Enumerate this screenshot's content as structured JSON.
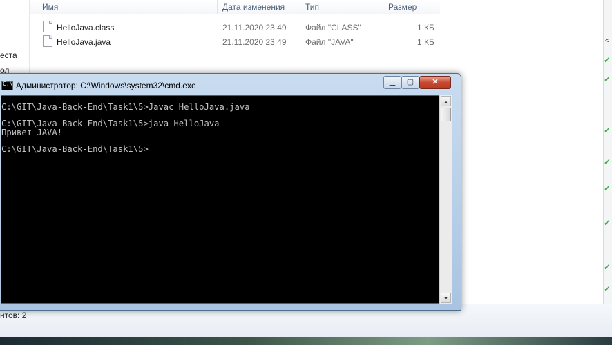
{
  "explorer": {
    "columns": {
      "name": "Имя",
      "date": "Дата изменения",
      "type": "Тип",
      "size": "Размер"
    },
    "files": [
      {
        "name": "HelloJava.class",
        "date": "21.11.2020 23:49",
        "type": "Файл \"CLASS\"",
        "size": "1 КБ"
      },
      {
        "name": "HelloJava.java",
        "date": "21.11.2020 23:49",
        "type": "Файл \"JAVA\"",
        "size": "1 КБ"
      }
    ],
    "nav_items": [
      "еста",
      "ол"
    ],
    "status": "нтов: 2"
  },
  "cmd": {
    "title": "Администратор: C:\\Windows\\system32\\cmd.exe",
    "icon_label": "C:\\",
    "console_text": "C:\\GIT\\Java-Back-End\\Task1\\5>Javac HelloJava.java\n\nC:\\GIT\\Java-Back-End\\Task1\\5>java HelloJava\nПривет JAVA!\n\nC:\\GIT\\Java-Back-End\\Task1\\5>"
  }
}
